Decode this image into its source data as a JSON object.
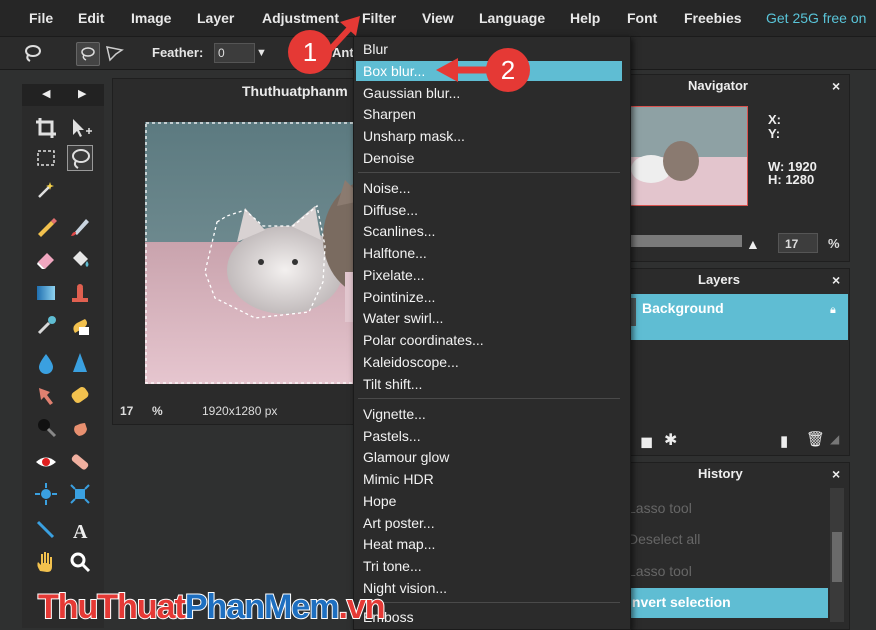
{
  "menubar": {
    "items": [
      "File",
      "Edit",
      "Image",
      "Layer",
      "Adjustment",
      "Filter",
      "View",
      "Language",
      "Help",
      "Font",
      "Freebies"
    ],
    "promo": "Get 25G free on"
  },
  "options": {
    "feather_label": "Feather:",
    "feather_value": "0",
    "antialias_label": "Ant"
  },
  "canvas": {
    "title": "Thuthuatphanm",
    "zoom": "17",
    "zoom_unit": "%",
    "dimensions": "1920x1280 px"
  },
  "navigator": {
    "title": "Navigator",
    "x_label": "X:",
    "y_label": "Y:",
    "w_label": "W: 1920",
    "h_label": "H: 1280",
    "zoom": "17",
    "zoom_unit": "%",
    "close": "×"
  },
  "layers": {
    "title": "Layers",
    "items": [
      "Background"
    ],
    "close": "×"
  },
  "history": {
    "title": "History",
    "items": [
      "Lasso tool",
      "Deselect all",
      "Lasso tool",
      "Invert selection"
    ],
    "close": "×"
  },
  "filter_menu": {
    "items": [
      "Blur",
      "Box blur...",
      "Gaussian blur...",
      "Sharpen",
      "Unsharp mask...",
      "Denoise",
      "Noise...",
      "Diffuse...",
      "Scanlines...",
      "Halftone...",
      "Pixelate...",
      "Pointinize...",
      "Water swirl...",
      "Polar coordinates...",
      "Kaleidoscope...",
      "Tilt shift...",
      "Vignette...",
      "Pastels...",
      "Glamour glow",
      "Mimic HDR",
      "Hope",
      "Art poster...",
      "Heat map...",
      "Tri tone...",
      "Night vision...",
      "Emboss"
    ],
    "highlighted": "Box blur..."
  },
  "callouts": {
    "one": "1",
    "two": "2"
  },
  "watermark": {
    "part1": "ThuThuat",
    "part2": "PhanMem",
    "part3": ".vn"
  },
  "colors": {
    "accent": "#5fbdd3",
    "callout": "#e53935",
    "promo": "#59c4d8"
  },
  "icons": [
    "lasso-icon",
    "polygon-lasso-icon",
    "magnetic-lasso-icon",
    "crop-icon",
    "move-icon",
    "marquee-icon",
    "wand-icon",
    "pencil-icon",
    "brush-icon",
    "eraser-icon",
    "fill-icon",
    "gradient-icon",
    "stamp-icon",
    "picker-icon",
    "smudge-icon",
    "drop-icon",
    "sharpen-icon",
    "dodge-icon",
    "sponge-icon",
    "redeye-icon",
    "bloat-icon",
    "pinch-icon",
    "text-icon",
    "hand-icon",
    "zoom-icon",
    "trash-icon",
    "lock-icon"
  ]
}
